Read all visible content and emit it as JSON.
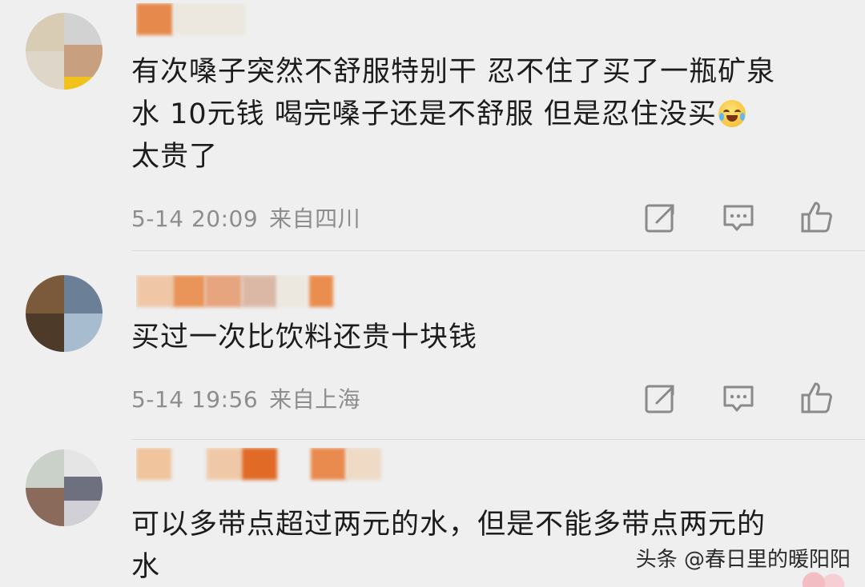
{
  "comments": [
    {
      "text_lines": [
        "有次嗓子突然不舒服特别干  忍不住了买了一瓶矿泉",
        "水 10元钱   喝完嗓子还是不舒服   但是忍住没买",
        "太贵了"
      ],
      "emoji": "crying-laughing-emoji",
      "time": "5-14 20:09",
      "location": "来自四川"
    },
    {
      "text_lines": [
        "买过一次比饮料还贵十块钱"
      ],
      "time": "5-14 19:56",
      "location": "来自上海"
    },
    {
      "text_lines": [
        "可以多带点超过两元的水，但是不能多带点两元的",
        "水"
      ]
    }
  ],
  "actions": {
    "share_icon": "share-icon",
    "reply_icon": "reply-icon",
    "like_icon": "thumbs-up-icon"
  },
  "watermark": "头条 @春日里的暖阳阳",
  "colors": {
    "background": "#efefef",
    "text": "#1c1c1c",
    "meta": "#8d8d8d",
    "blur_orange": "#e88a4c"
  }
}
